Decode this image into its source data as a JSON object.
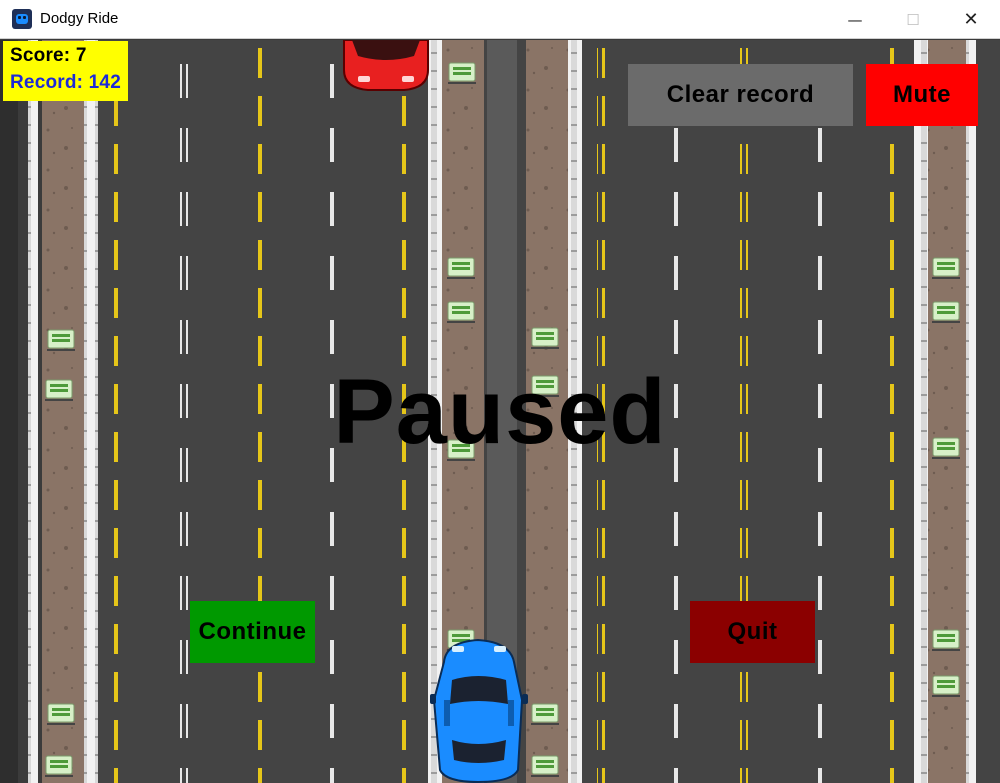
{
  "window": {
    "title": "Dodgy Ride",
    "minimize_glyph": "—",
    "maximize_glyph": "☐",
    "close_glyph": "✕"
  },
  "hud": {
    "score": "Score: 7",
    "record": "Record: 142"
  },
  "buttons": {
    "clear_record": "Clear record",
    "mute": "Mute",
    "continue": "Continue",
    "quit": "Quit"
  },
  "overlay": {
    "status": "Paused"
  },
  "colors": {
    "score_bg": "#ffff00",
    "record_text": "#1d2ad8",
    "clear_record_bg": "#6b6b6b",
    "mute_bg": "#ff0000",
    "continue_bg": "#009900",
    "quit_bg": "#8b0000",
    "player_car": "#1a8cff",
    "enemy_car": "#e82020"
  },
  "icons": {
    "app": "car-icon",
    "signs": "road-sign-icon"
  }
}
